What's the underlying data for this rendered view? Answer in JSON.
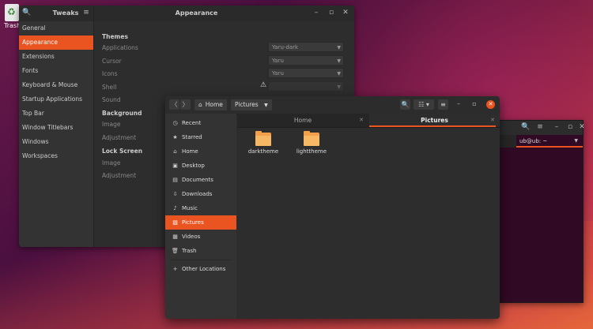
{
  "desktop": {
    "trash_label": "Trash"
  },
  "tweaks": {
    "app_name": "Tweaks",
    "page_title": "Appearance",
    "sidebar": [
      "General",
      "Appearance",
      "Extensions",
      "Fonts",
      "Keyboard & Mouse",
      "Startup Applications",
      "Top Bar",
      "Window Titlebars",
      "Windows",
      "Workspaces"
    ],
    "active_item": "Appearance",
    "themes": {
      "title": "Themes",
      "applications_label": "Applications",
      "applications_value": "Yaru-dark",
      "cursor_label": "Cursor",
      "cursor_value": "Yaru",
      "icons_label": "Icons",
      "icons_value": "Yaru",
      "shell_label": "Shell",
      "sound_label": "Sound"
    },
    "background": {
      "title": "Background",
      "image_label": "Image",
      "adjustment_label": "Adjustment"
    },
    "lock_screen": {
      "title": "Lock Screen",
      "image_label": "Image",
      "adjustment_label": "Adjustment"
    }
  },
  "terminal": {
    "tab_label": "ub@ub: ~"
  },
  "files": {
    "breadcrumb": {
      "home": "Home",
      "current": "Pictures"
    },
    "sidebar": {
      "recent": "Recent",
      "starred": "Starred",
      "home": "Home",
      "desktop": "Desktop",
      "documents": "Documents",
      "downloads": "Downloads",
      "music": "Music",
      "pictures": "Pictures",
      "videos": "Videos",
      "trash": "Trash",
      "other_locations": "Other Locations"
    },
    "tabs": {
      "home": "Home",
      "pictures": "Pictures"
    },
    "folders": {
      "f1": "darktheme",
      "f2": "lighttheme"
    }
  },
  "colors": {
    "accent": "#e95420",
    "folder": "#f2a14a"
  }
}
